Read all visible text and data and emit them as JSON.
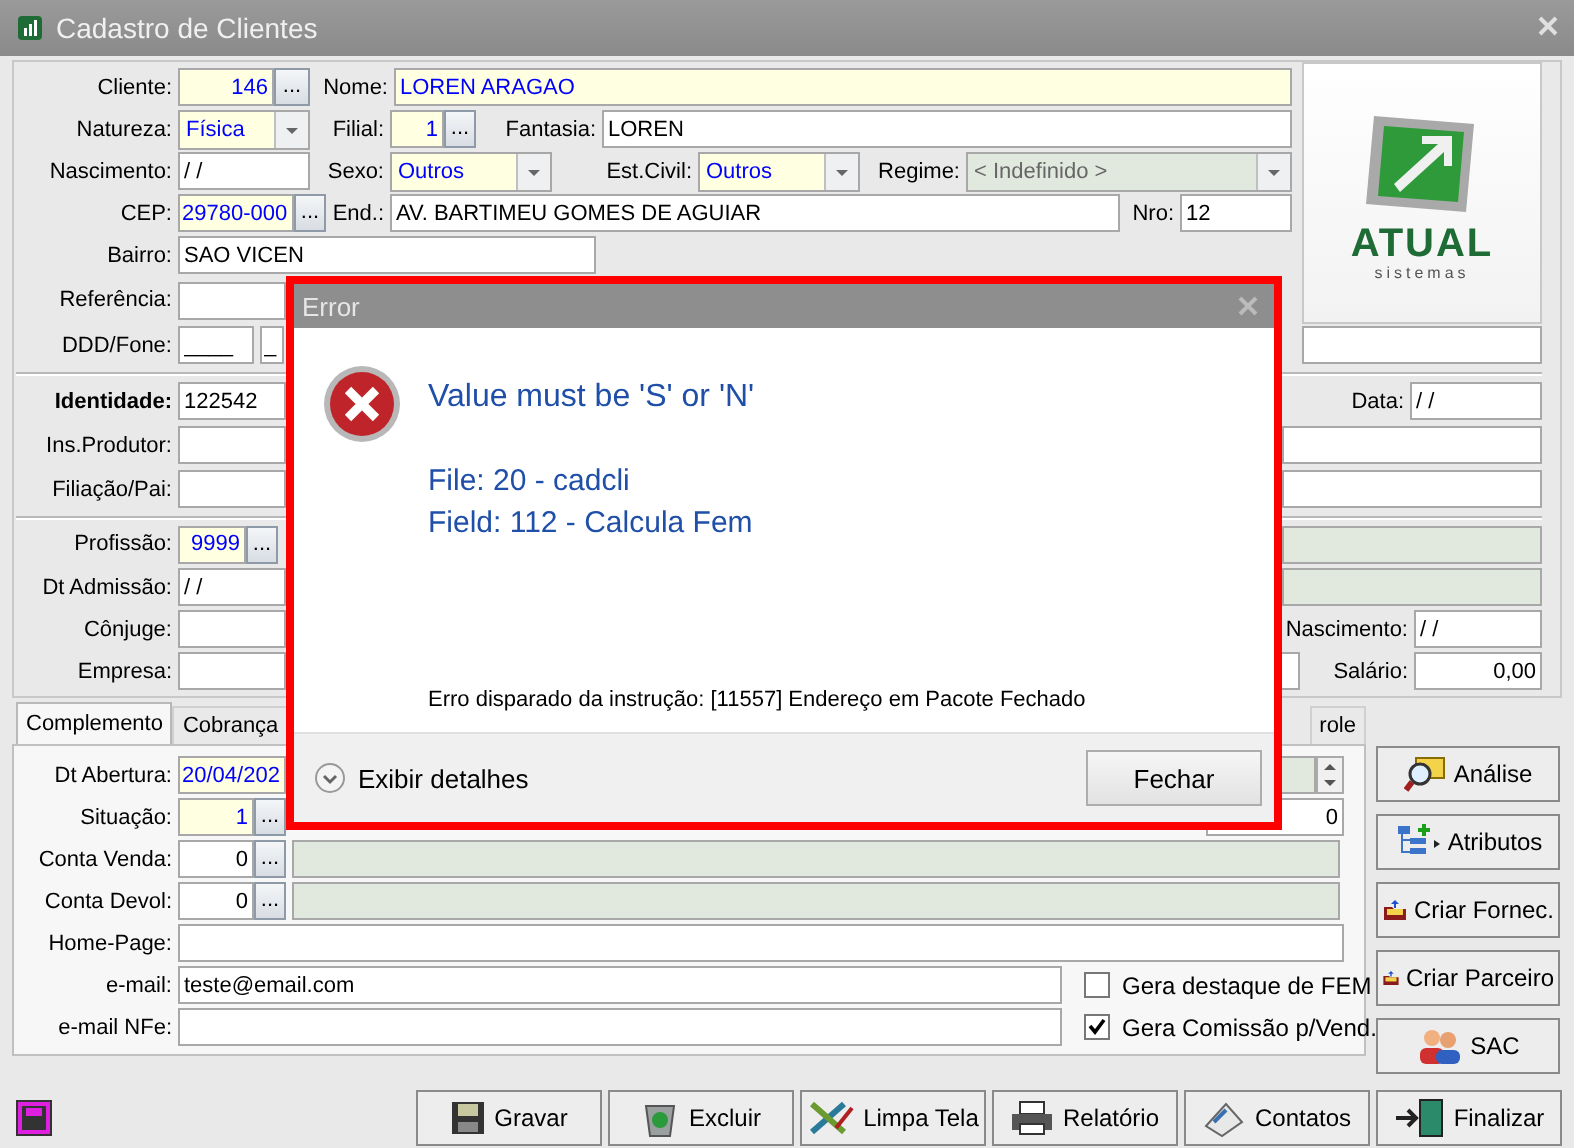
{
  "window": {
    "title": "Cadastro de Clientes"
  },
  "logo": {
    "name": "ATUAL",
    "tagline": "sistemas"
  },
  "main": {
    "cliente": {
      "label": "Cliente:",
      "value": "146",
      "button": "...",
      "required": true
    },
    "nome": {
      "label": "Nome:",
      "value": "LOREN ARAGAO",
      "required": true
    },
    "natureza": {
      "label": "Natureza:",
      "value": "Física",
      "required": true
    },
    "filial": {
      "label": "Filial:",
      "value": "1",
      "button": "...",
      "required": true
    },
    "fantasia": {
      "label": "Fantasia:",
      "value": "LOREN",
      "required": false
    },
    "nascimento": {
      "label": "Nascimento:",
      "value": "/ /",
      "required": false
    },
    "sexo": {
      "label": "Sexo:",
      "value": "Outros",
      "required": true
    },
    "est_civil": {
      "label": "Est.Civil:",
      "value": "Outros",
      "required": true
    },
    "regime": {
      "label": "Regime:",
      "value": "< Indefinido >",
      "disabled": true
    },
    "cep": {
      "label": "CEP:",
      "value": "29780-000",
      "button": "...",
      "required": true
    },
    "endereco": {
      "label": "End.:",
      "value": "AV. BARTIMEU GOMES DE AGUIAR",
      "required": false
    },
    "nro": {
      "label": "Nro:",
      "value": "12",
      "required": false
    },
    "bairro": {
      "label": "Bairro:",
      "value": "SAO VICEN",
      "required": false
    },
    "referencia": {
      "label": "Referência:",
      "required": false
    },
    "ddd_fone": {
      "label": "DDD/Fone:",
      "ddd": "____",
      "fone": "_"
    },
    "identidade": {
      "label": "Identidade:",
      "value": "122542"
    },
    "data": {
      "label": "Data:",
      "value": "/ /"
    },
    "ins_produtor": {
      "label": "Ins.Produtor:"
    },
    "filiacao_pai": {
      "label": "Filiação/Pai:"
    },
    "profissao": {
      "label": "Profissão:",
      "value": "9999",
      "button": "...",
      "required": true
    },
    "profissao_desc": {
      "disabled": true
    },
    "dt_admissao": {
      "label": "Dt Admissão:",
      "value": "/ /"
    },
    "dt_admissao_extra": {
      "disabled": true
    },
    "conjuge": {
      "label": "Cônjuge:"
    },
    "conjuge_nascimento": {
      "label": "Nascimento:",
      "value": "/ /"
    },
    "empresa": {
      "label": "Empresa:"
    },
    "salario": {
      "label": "Salário:",
      "value": "0,00"
    }
  },
  "tabs": [
    {
      "label": "Complemento",
      "selected": true
    },
    {
      "label": "Cobrança",
      "selected": false
    },
    {
      "label": "role",
      "selected": false
    }
  ],
  "complemento": {
    "dt_abertura": {
      "label": "Dt Abertura:",
      "value": "20/04/202",
      "required": true
    },
    "dt_abertura_spin": {
      "disabled": true
    },
    "situacao": {
      "label": "Situação:",
      "value": "1",
      "button": "...",
      "required": true
    },
    "situacao_extra": {
      "value": "0"
    },
    "conta_venda": {
      "label": "Conta Venda:",
      "value": "0",
      "button": "...",
      "required": false
    },
    "conta_venda_desc": {
      "disabled": true
    },
    "conta_devol": {
      "label": "Conta Devol:",
      "value": "0",
      "button": "...",
      "required": false
    },
    "conta_devol_desc": {
      "disabled": true
    },
    "home_page": {
      "label": "Home-Page:"
    },
    "email": {
      "label": "e-mail:",
      "value": "teste@email.com"
    },
    "email_nfe": {
      "label": "e-mail NFe:"
    },
    "checkboxes": [
      {
        "label": "Gera destaque de FEM",
        "checked": false
      },
      {
        "label": "Gera Comissão p/Vend.",
        "checked": true
      }
    ]
  },
  "side_buttons": [
    {
      "label": "Análise"
    },
    {
      "label": "Atributos"
    },
    {
      "label": "Criar Fornec."
    },
    {
      "label": "Criar Parceiro"
    },
    {
      "label": "SAC"
    }
  ],
  "bottom_buttons": [
    {
      "label": "Gravar"
    },
    {
      "label": "Excluir"
    },
    {
      "label": "Limpa Tela"
    },
    {
      "label": "Relatório"
    },
    {
      "label": "Contatos"
    },
    {
      "label": "Finalizar"
    }
  ],
  "dialog": {
    "title": "Error",
    "message": "Value must be 'S' or 'N'",
    "details": [
      "File: 20 - cadcli",
      "Field: 112 - Calcula Fem"
    ],
    "source": "Erro disparado da instrução: [11557] Endereço em Pacote Fechado",
    "toggle": "Exibir detalhes",
    "button": "Fechar"
  }
}
